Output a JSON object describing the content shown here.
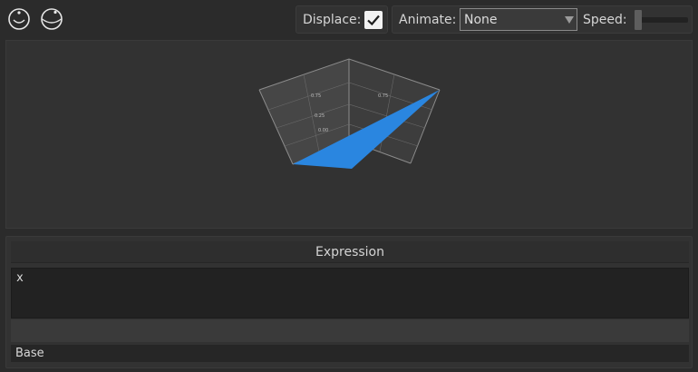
{
  "toolbar": {
    "icons": [
      "sphere-icon",
      "sphere-tilted-icon"
    ],
    "displace": {
      "label": "Displace:",
      "checked": true
    },
    "animate": {
      "label": "Animate:",
      "value": "None"
    },
    "speed": {
      "label": "Speed:",
      "value": 0
    }
  },
  "viewport": {
    "axis_tick_labels": [
      "0.75",
      "0.75",
      "0.25",
      "0.00"
    ],
    "surface_color": "#2a86e0"
  },
  "expression": {
    "header": "Expression",
    "value": "x",
    "base_label": "Base"
  },
  "colors": {
    "background": "#2b2b2b",
    "panel": "#323232",
    "surface": "#2a86e0"
  }
}
